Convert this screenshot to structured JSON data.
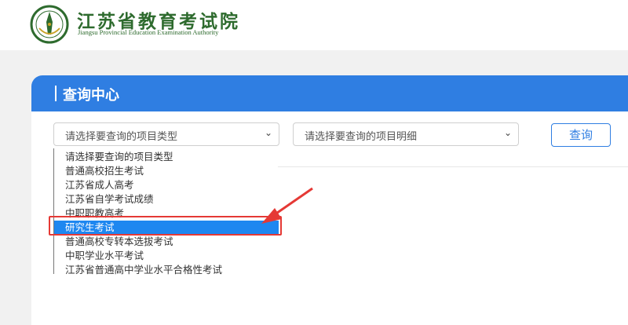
{
  "header": {
    "title_cn": "江苏省教育考试院",
    "title_en": "Jiangsu Provincial Education Examination Authority",
    "logo_icon": "education-authority-emblem"
  },
  "panel": {
    "title": "查询中心"
  },
  "filters": {
    "type_select_value": "请选择要查询的项目类型",
    "detail_select_value": "请选择要查询的项目明细",
    "query_button": "查询"
  },
  "dropdown": {
    "options": [
      "请选择要查询的项目类型",
      "普通高校招生考试",
      "江苏省成人高考",
      "江苏省自学考试成绩",
      "中职职教高考",
      "研究生考试",
      "普通高校专转本选拔考试",
      "中职学业水平考试",
      "江苏省普通高中学业水平合格性考试"
    ],
    "highlighted_index": 5
  },
  "annotation": {
    "highlight_color": "#e53935"
  },
  "colors": {
    "brand_blue": "#2f7ee2",
    "brand_green": "#2e6b2e",
    "selection_blue": "#1e87f0"
  }
}
